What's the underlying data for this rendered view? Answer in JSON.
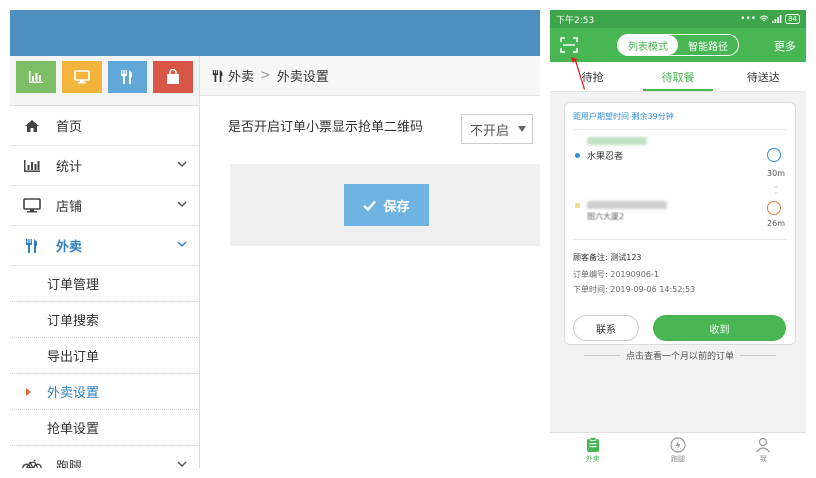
{
  "admin": {
    "quick_buttons": [
      {
        "icon": "bar-chart-icon",
        "color": "#7cbf66"
      },
      {
        "icon": "monitor-icon",
        "color": "#f2b43a"
      },
      {
        "icon": "fork-knife-icon",
        "color": "#5fa8d9"
      },
      {
        "icon": "shopping-bag-icon",
        "color": "#d95646"
      }
    ],
    "menu": {
      "home": "首页",
      "stats": "统计",
      "store": "店铺",
      "takeout": "外卖",
      "errand": "跑腿"
    },
    "submenu": [
      "订单管理",
      "订单搜索",
      "导出订单",
      "外卖设置",
      "抢单设置"
    ],
    "breadcrumb": {
      "parent": "外卖",
      "sep": ">",
      "current": "外卖设置"
    },
    "form": {
      "label": "是否开启订单小票显示抢单二维码",
      "select_value": "不开启",
      "save_label": "保存"
    },
    "colors": {
      "topbar": "#4d8fbf",
      "primary_text": "#2f7fbf",
      "save": "#6fb3e0"
    }
  },
  "phone": {
    "status_time": "下午2:53",
    "status_battery": "84",
    "mode_list": "列表模式",
    "mode_route": "智能路径",
    "more": "更多",
    "tabs": [
      "待抢",
      "待取餐",
      "待送达"
    ],
    "card": {
      "eta": "距用户期望时间 剩余39分钟",
      "shop": "水果忍者",
      "dist1": "30m",
      "dist2": "26m",
      "address_fragment": "图六大厦2",
      "note": "顾客备注: 测试123",
      "order_no": "订单编号: 20190906-1",
      "order_time": "下单时间: 2019-09-06 14:52:53",
      "contact": "联系",
      "receive": "收到"
    },
    "older_orders": "点击查看一个月以前的订单",
    "bottom_nav": [
      "外卖",
      "跑腿",
      "我"
    ],
    "colors": {
      "green": "#47b653",
      "status_green": "#3ea64a",
      "eta_blue": "#2e8fe0",
      "arrow_red": "#e02020"
    }
  }
}
